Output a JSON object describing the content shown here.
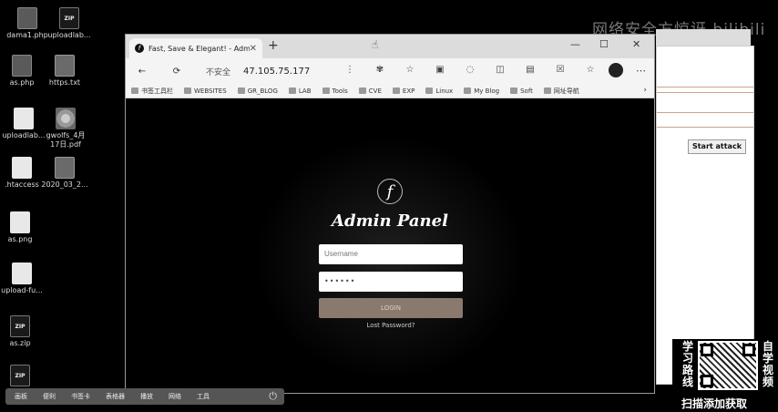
{
  "watermark": "网络安全方惊讶 bilibili",
  "desktop_icons": [
    {
      "label": "dama1.php",
      "icon": "php-file-icon"
    },
    {
      "label": "uploadlab...",
      "icon": "zip-file-icon"
    },
    {
      "label": "as.php",
      "icon": "php-file-icon"
    },
    {
      "label": "https.txt",
      "icon": "text-file-icon"
    },
    {
      "label": "uploadlab...",
      "icon": "file-icon"
    },
    {
      "label": "gwolfs_4月17日.pdf",
      "icon": "chrome-icon"
    },
    {
      "label": ".htaccess",
      "icon": "file-icon"
    },
    {
      "label": "2020_03_2...",
      "icon": "image-file-icon"
    },
    {
      "label": "as.png",
      "icon": "image-file-icon"
    },
    {
      "label": "upload-fu...",
      "icon": "file-icon"
    },
    {
      "label": "as.zip",
      "icon": "zip-file-icon"
    },
    {
      "label": "",
      "icon": "zip-file-icon"
    }
  ],
  "browser": {
    "tab_title": "Fast, Save & Elegant! - AdminP...",
    "new_tab": "+",
    "insecure_label": "不安全",
    "url": "47.105.75.177",
    "bookmarks": [
      "书签工具栏",
      "WEBSITES",
      "GR_BLOG",
      "LAB",
      "Tools",
      "CVE",
      "EXP",
      "Linux",
      "My Blog",
      "Soft",
      "网址导航"
    ]
  },
  "login": {
    "title": "Admin Panel",
    "username_placeholder": "Username",
    "password_value": "••••••",
    "login_button": "LOGIN",
    "lost_password": "Lost Password?"
  },
  "side_panel": {
    "start_button": "Start attack"
  },
  "taskbar": {
    "items": [
      "画板",
      "便利",
      "书签卡",
      "表格器",
      "播放",
      "网络",
      "工具"
    ]
  },
  "promo": {
    "left": [
      "学",
      "习",
      "路",
      "线"
    ],
    "right": [
      "自",
      "学",
      "视",
      "频"
    ],
    "bottom": "扫描添加获取"
  }
}
